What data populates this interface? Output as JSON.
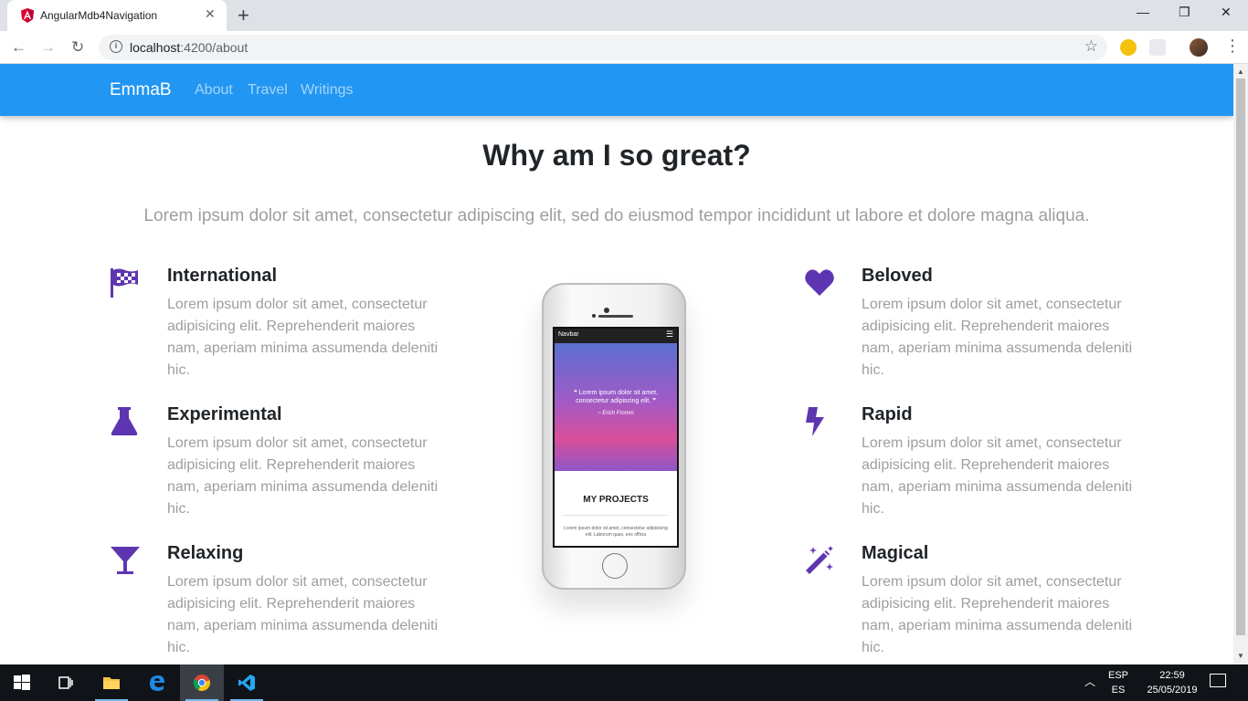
{
  "browser": {
    "tab_title": "AngularMdb4Navigation",
    "tab_close": "✕",
    "new_tab": "+",
    "url_host": "localhost",
    "url_path": ":4200/about",
    "back": "←",
    "forward": "→",
    "reload": "↻",
    "bookmark": "☆",
    "minimize": "—",
    "restore": "❐",
    "close": "✕",
    "menu": "⋮"
  },
  "navbar": {
    "brand": "EmmaB",
    "links": [
      "About",
      "Travel",
      "Writings"
    ]
  },
  "page": {
    "heading": "Why am I so great?",
    "lead": "Lorem ipsum dolor sit amet, consectetur adipiscing elit, sed do eiusmod tempor incididunt ut labore et dolore magna aliqua."
  },
  "features": {
    "left": [
      {
        "title": "International",
        "icon": "flag-checkered-icon",
        "text": "Lorem ipsum dolor sit amet, consectetur adipisicing elit. Reprehenderit maiores nam, aperiam minima assumenda deleniti hic."
      },
      {
        "title": "Experimental",
        "icon": "flask-icon",
        "text": "Lorem ipsum dolor sit amet, consectetur adipisicing elit. Reprehenderit maiores nam, aperiam minima assumenda deleniti hic."
      },
      {
        "title": "Relaxing",
        "icon": "glass-martini-icon",
        "text": "Lorem ipsum dolor sit amet, consectetur adipisicing elit. Reprehenderit maiores nam, aperiam minima assumenda deleniti hic."
      }
    ],
    "right": [
      {
        "title": "Beloved",
        "icon": "heart-icon",
        "text": "Lorem ipsum dolor sit amet, consectetur adipisicing elit. Reprehenderit maiores nam, aperiam minima assumenda deleniti hic."
      },
      {
        "title": "Rapid",
        "icon": "bolt-icon",
        "text": "Lorem ipsum dolor sit amet, consectetur adipisicing elit. Reprehenderit maiores nam, aperiam minima assumenda deleniti hic."
      },
      {
        "title": "Magical",
        "icon": "magic-wand-icon",
        "text": "Lorem ipsum dolor sit amet, consectetur adipisicing elit. Reprehenderit maiores nam, aperiam minima assumenda deleniti hic."
      }
    ]
  },
  "phone_screen": {
    "navbar": "Navbar",
    "quote": "❝ Lorem ipsum dolor sit amet, consectetur adipiscing elit. ❞",
    "author": "~ Erich Fromm",
    "title": "MY PROJECTS",
    "text": "Lorem ipsum dolor sit amet, consectetur adipisicing elit. Laborum quas, eos officia"
  },
  "taskbar": {
    "lang_top": "ESP",
    "lang_bottom": "ES",
    "time": "22:59",
    "date": "25/05/2019"
  },
  "colors": {
    "navbar": "#2196f3",
    "icon": "#5e35b1"
  }
}
